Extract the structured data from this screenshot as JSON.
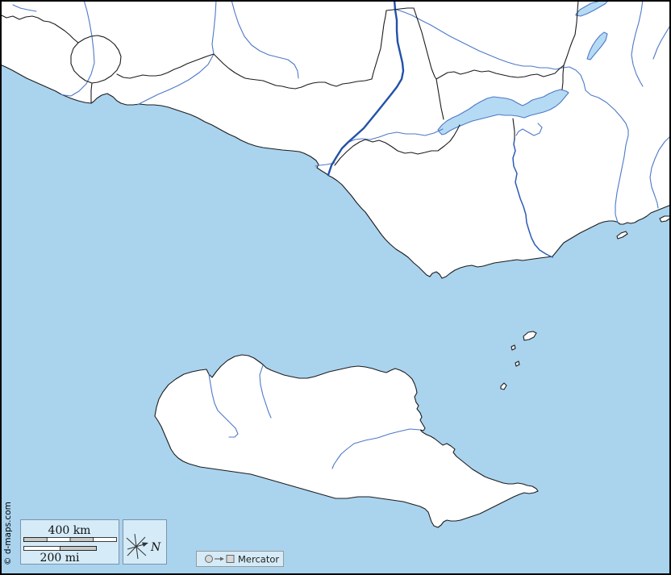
{
  "attribution": {
    "text": "© d-maps.com"
  },
  "legend": {
    "scale": {
      "km": "400 km",
      "mi": "200 mi"
    },
    "compass": {
      "north": "N"
    },
    "projection": {
      "name": "Mercator"
    }
  },
  "colors": {
    "sea": "#aad3ee",
    "land": "#ffffff",
    "coast": "#1c1c1c",
    "border": "#1c1c1c",
    "river": "#4d79c7",
    "river_major": "#2251a8",
    "river_medium": "#2c5cb3",
    "lake_fill": "#b5daf3",
    "lake_stroke": "#4d79c7",
    "legend_box_fill": "#d5ecf8",
    "legend_box_border": "#7e93a8",
    "scale_gray": "#c9c9c9",
    "glyph_gray": "#d9d9d9",
    "text_color": "#111111",
    "frame": "#000000"
  }
}
